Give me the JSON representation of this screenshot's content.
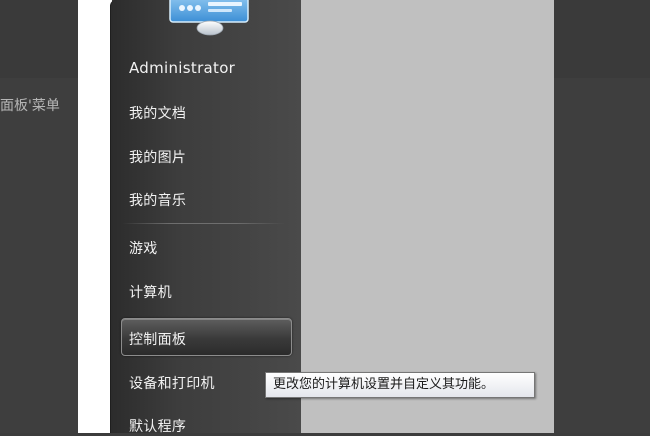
{
  "article": {
    "snippet": "面板'菜单"
  },
  "start_menu": {
    "user_name": "Administrator",
    "items": [
      {
        "label": "我的文档"
      },
      {
        "label": "我的图片"
      },
      {
        "label": "我的音乐"
      },
      {
        "label": "游戏"
      },
      {
        "label": "计算机"
      },
      {
        "label": "控制面板"
      },
      {
        "label": "设备和打印机"
      },
      {
        "label": "默认程序"
      }
    ],
    "highlighted_item": "控制面板"
  },
  "tooltip": {
    "text": "更改您的计算机设置并自定义其功能。"
  },
  "colors": {
    "menu_text": "#f2f2f2",
    "right_panel": "#c0c0c0",
    "tooltip_bg": "#ffffff",
    "background": "#3c3c3c"
  },
  "icons": {
    "avatar": "user-avatar-icon"
  }
}
